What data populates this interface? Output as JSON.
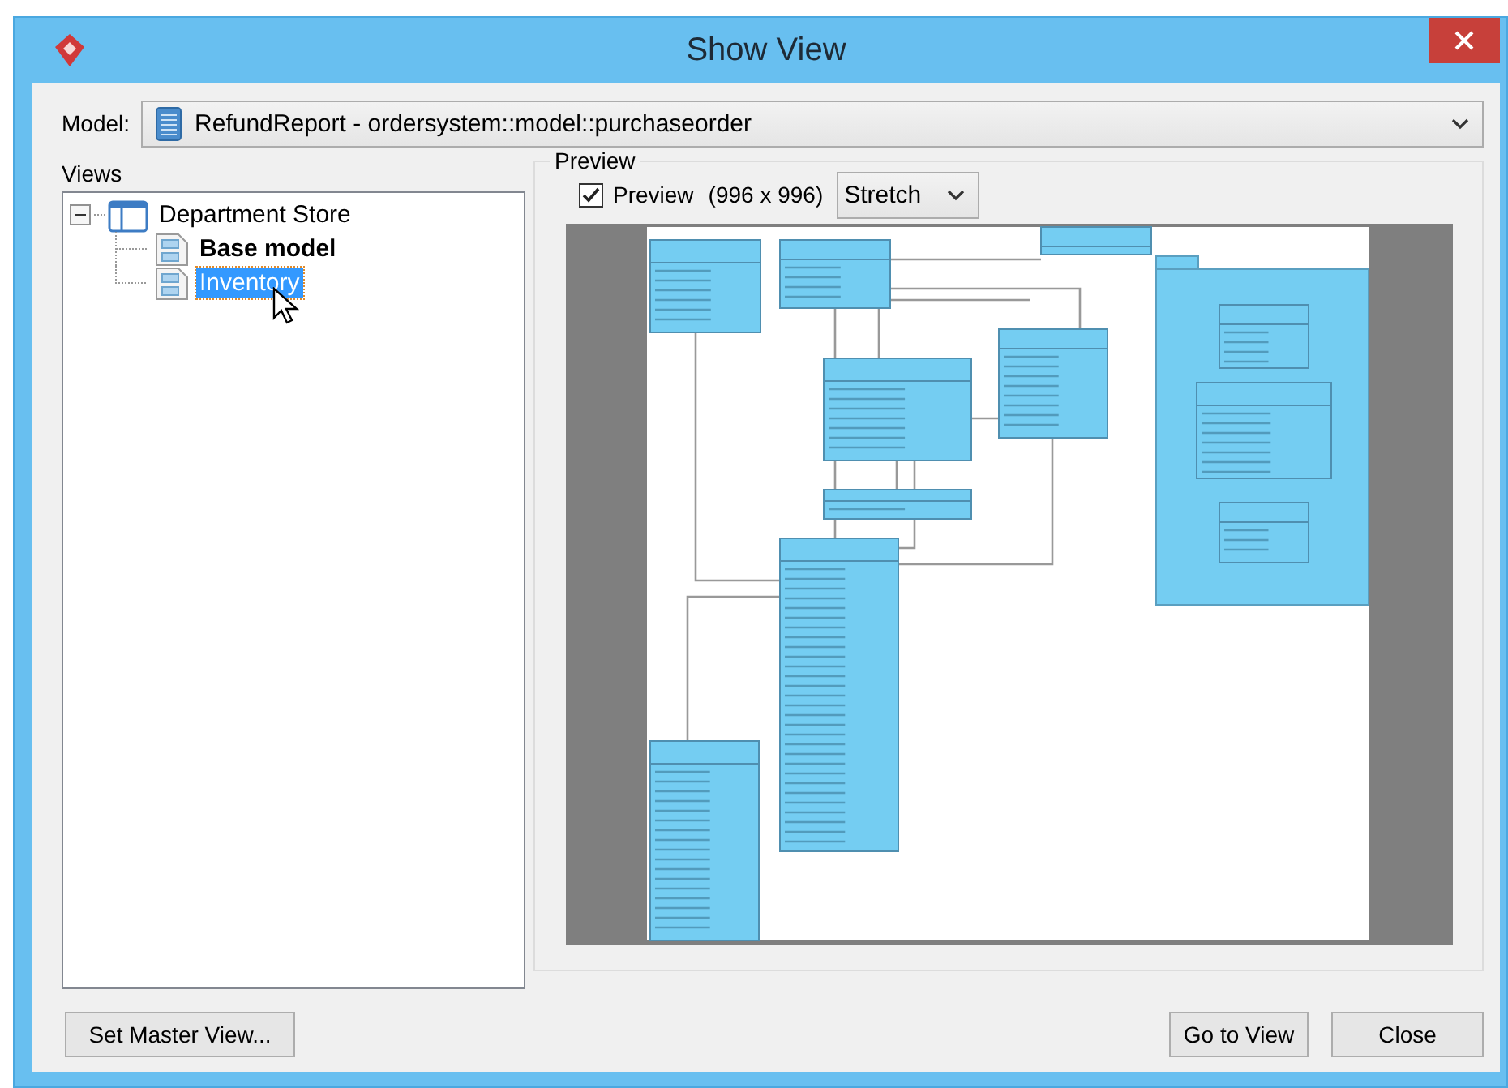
{
  "window": {
    "title": "Show View"
  },
  "model": {
    "label": "Model:",
    "value": "RefundReport - ordersystem::model::purchaseorder"
  },
  "views": {
    "label": "Views",
    "tree": [
      {
        "label": "Department Store",
        "kind": "root",
        "expanded": true,
        "selected": false,
        "children": [
          {
            "label": "Base model",
            "kind": "diagram",
            "bold": true,
            "selected": false
          },
          {
            "label": "Inventory",
            "kind": "diagram",
            "bold": false,
            "selected": true
          }
        ]
      }
    ]
  },
  "preview": {
    "group_label": "Preview",
    "checkbox_label": "Preview",
    "checked": true,
    "size": "(996 x 996)",
    "scale": "Stretch",
    "thumbnail": {
      "kind": "class-diagram"
    }
  },
  "buttons": [
    {
      "label": "Set Master View...",
      "kind": "left"
    },
    {
      "label": "Go to View",
      "kind": "right"
    },
    {
      "label": "Close",
      "kind": "right"
    }
  ]
}
